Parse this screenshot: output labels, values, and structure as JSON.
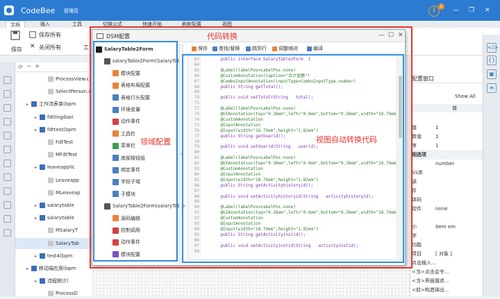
{
  "app": {
    "name": "CodeBee",
    "user": "管理员",
    "notifications": "1",
    "window_controls": [
      "—",
      "❐",
      "✕"
    ]
  },
  "ribbon": {
    "tabs": [
      "文档",
      "插入",
      "工具",
      "切换公式",
      "快速开始",
      "刷新配置",
      "视图"
    ],
    "buttons": [
      {
        "label": "保存",
        "icon": "save-icon"
      },
      {
        "label": "保存所有",
        "icon": "save-all-icon"
      },
      {
        "label": "关闭所有",
        "icon": "close-all-icon"
      },
      {
        "label": "工",
        "icon": "tool-icon"
      }
    ]
  },
  "tree": {
    "items": [
      {
        "label": "ProcessView.cl",
        "level": 3
      },
      {
        "label": "SelectPerson.cl",
        "level": 3
      },
      {
        "label": "工作流表单(bpm",
        "level": 1
      },
      {
        "label": "fdtlingdao(",
        "level": 2
      },
      {
        "label": "fdttest(bpm",
        "level": 2
      },
      {
        "label": "FdtTest",
        "level": 3
      },
      {
        "label": "MFdtTest",
        "level": 3
      },
      {
        "label": "leaveapplic",
        "level": 2
      },
      {
        "label": "Leaveapp",
        "level": 3
      },
      {
        "label": "MLeaveap",
        "level": 3
      },
      {
        "label": "salarytable",
        "level": 2
      },
      {
        "label": "salarytable",
        "level": 2
      },
      {
        "label": "MSalaryT",
        "level": 3
      },
      {
        "label": "SalaryTab",
        "level": 3,
        "selected": true
      },
      {
        "label": "test4(bpm",
        "level": 2
      },
      {
        "label": "移动端应用(bpm",
        "level": 1
      },
      {
        "label": "流程统计(",
        "level": 2
      },
      {
        "label": "ProcessD",
        "level": 3
      }
    ]
  },
  "dialog": {
    "title": "DSM配置",
    "left_tree": [
      {
        "label": "SalaryTable2Form",
        "level": 0,
        "bold": true
      },
      {
        "label": "salaryTable2Form(SalaryTab",
        "level": 1
      },
      {
        "label": "模块配置",
        "level": 2,
        "color": "#e8833a"
      },
      {
        "label": "表格布局配置",
        "level": 2,
        "color": "#e8833a"
      },
      {
        "label": "表格行头配置",
        "level": 2,
        "color": "#4a7fc0"
      },
      {
        "label": "环境变量",
        "level": 2,
        "color": "#4a7fc0"
      },
      {
        "label": "动作事件",
        "level": 2,
        "color": "#d64040"
      },
      {
        "label": "工具栏",
        "level": 2,
        "color": "#e8833a"
      },
      {
        "label": "菜单栏",
        "level": 2,
        "color": "#3aa05a"
      },
      {
        "label": "底部按钮组",
        "level": 2,
        "color": "#4a7fc0"
      },
      {
        "label": "绑定事件",
        "level": 2,
        "color": "#4a7fc0"
      },
      {
        "label": "字段子域",
        "level": 2,
        "color": "#4a7fc0"
      },
      {
        "label": "子模块",
        "level": 2,
        "color": "#4a7fc0"
      },
      {
        "label": "SalaryTable2Form(salaryTable",
        "level": 1
      },
      {
        "label": "源码编辑",
        "level": 2,
        "color": "#e8833a"
      },
      {
        "label": "控制调用",
        "level": 2,
        "color": "#d64040"
      },
      {
        "label": "动作事件",
        "level": 2,
        "color": "#d64040"
      },
      {
        "label": "模块配置",
        "level": 2,
        "color": "#7a55c0"
      }
    ],
    "toolbar": [
      {
        "label": "保存",
        "color": "#e8833a"
      },
      {
        "label": "查找/替换",
        "color": "#4a7fc0"
      },
      {
        "label": "跳到行",
        "color": "#4a7fc0"
      },
      {
        "label": "调整缩进",
        "color": "#e8833a"
      },
      {
        "label": "编译",
        "color": "#4a7fc0"
      }
    ],
    "code_lines": [
      {
        "n": "63",
        "t": "    public interface SalaryTable2Form  {"
      },
      {
        "n": "64",
        "t": ""
      },
      {
        "n": "65",
        "t": "    @Label(labelPos=LabelPos.none)"
      },
      {
        "n": "66",
        "t": "    @CustomAnnotation(caption=\"合计金额\")"
      },
      {
        "n": "67",
        "t": "    @ComboInputAnnotation(inputType=ComboInputType.number)"
      },
      {
        "n": "68",
        "t": "    public String getTotal();"
      },
      {
        "n": "69",
        "t": ""
      },
      {
        "n": "70",
        "t": "    public void setTotal(String   total);"
      },
      {
        "n": "71",
        "t": ""
      },
      {
        "n": "72",
        "t": "    @Label(labelPos=LabelPos.none)"
      },
      {
        "n": "73",
        "t": "    @UIAnnotation(top=\"0.38em\",left=\"0.0em\",bottom=\"0.38em\",width=\"18.79em\",height=\"1.82em\")"
      },
      {
        "n": "74",
        "t": "    @CustomAnnotation"
      },
      {
        "n": "75",
        "t": "    @InputAnnotation"
      },
      {
        "n": "76",
        "t": "    @Input(width=\"18.79em\",height=\"1.82em\")"
      },
      {
        "n": "77",
        "t": "    public String getUserid();"
      },
      {
        "n": "78",
        "t": ""
      },
      {
        "n": "79",
        "t": "    public void setUserid(String   userid);"
      },
      {
        "n": "80",
        "t": ""
      },
      {
        "n": "81",
        "t": "    @Label(labelPos=LabelPos.none)"
      },
      {
        "n": "82",
        "t": "    @UIAnnotation(top=\"0.38em\",left=\"0.0em\",bottom=\"0.38em\",width=\"18.79em\",height=\"1.82em\")"
      },
      {
        "n": "83",
        "t": "    @CustomAnnotation"
      },
      {
        "n": "84",
        "t": "    @InputAnnotation"
      },
      {
        "n": "85",
        "t": "    @Input(width=\"18.79em\",height=\"1.82em\")"
      },
      {
        "n": "86",
        "t": "    public String getActivityhistoryid();"
      },
      {
        "n": "87",
        "t": ""
      },
      {
        "n": "88",
        "t": "    public void setActivityhistoryid(String   activityhistoryid);"
      },
      {
        "n": "89",
        "t": ""
      },
      {
        "n": "90",
        "t": "    @Label(labelPos=LabelPos.none)"
      },
      {
        "n": "91",
        "t": "    @UIAnnotation(top=\"0.38em\",left=\"0.0em\",bottom=\"0.38em\",width=\"18.79em\",height=\"1.82em\")"
      },
      {
        "n": "92",
        "t": "    @CustomAnnotation"
      },
      {
        "n": "93",
        "t": "    @InputAnnotation"
      },
      {
        "n": "94",
        "t": "    @Input(width=\"18.79em\",height=\"1.82em\")"
      },
      {
        "n": "95",
        "t": "    public String getActivityinstid();"
      },
      {
        "n": "96",
        "t": ""
      },
      {
        "n": "97",
        "t": "    public void setActivityinstid(String   activityinstid);"
      },
      {
        "n": "98",
        "t": ""
      }
    ]
  },
  "annotations": {
    "code_convert": "代码转换",
    "domain_config": "领域配置",
    "view_auto_convert": "视图自动转换代码"
  },
  "properties": {
    "title": "配置窗口",
    "show_all": "Show All",
    "value_header": "值",
    "rows": [
      {
        "k": "",
        "v": ""
      },
      {
        "k": "值",
        "v": "1",
        "grp": false
      },
      {
        "k": "数值",
        "v": "1"
      },
      {
        "k": "序",
        "v": "1"
      },
      {
        "k": "相选项",
        "v": "",
        "grp": true
      },
      {
        "k": "",
        "v": "number"
      },
      {
        "k": "SS类",
        "v": ""
      },
      {
        "k": "读",
        "v": ""
      },
      {
        "k": "件",
        "v": ""
      },
      {
        "k": "体码",
        "v": ""
      },
      {
        "k": "控件",
        "v": "none"
      },
      {
        "k": "",
        "v": ""
      },
      {
        "k": "小",
        "v": "0em em"
      },
      {
        "k": "字",
        "v": ""
      },
      {
        "k": "功能",
        "v": ""
      },
      {
        "k": "项目",
        "v": "[ 对象 ]"
      },
      {
        "k": "点击输入...",
        "v": ""
      },
      {
        "k": "<当>点击会令...",
        "v": ""
      },
      {
        "k": "<当>界面描述...",
        "v": ""
      },
      {
        "k": "<前>构造弹出...",
        "v": ""
      }
    ]
  }
}
